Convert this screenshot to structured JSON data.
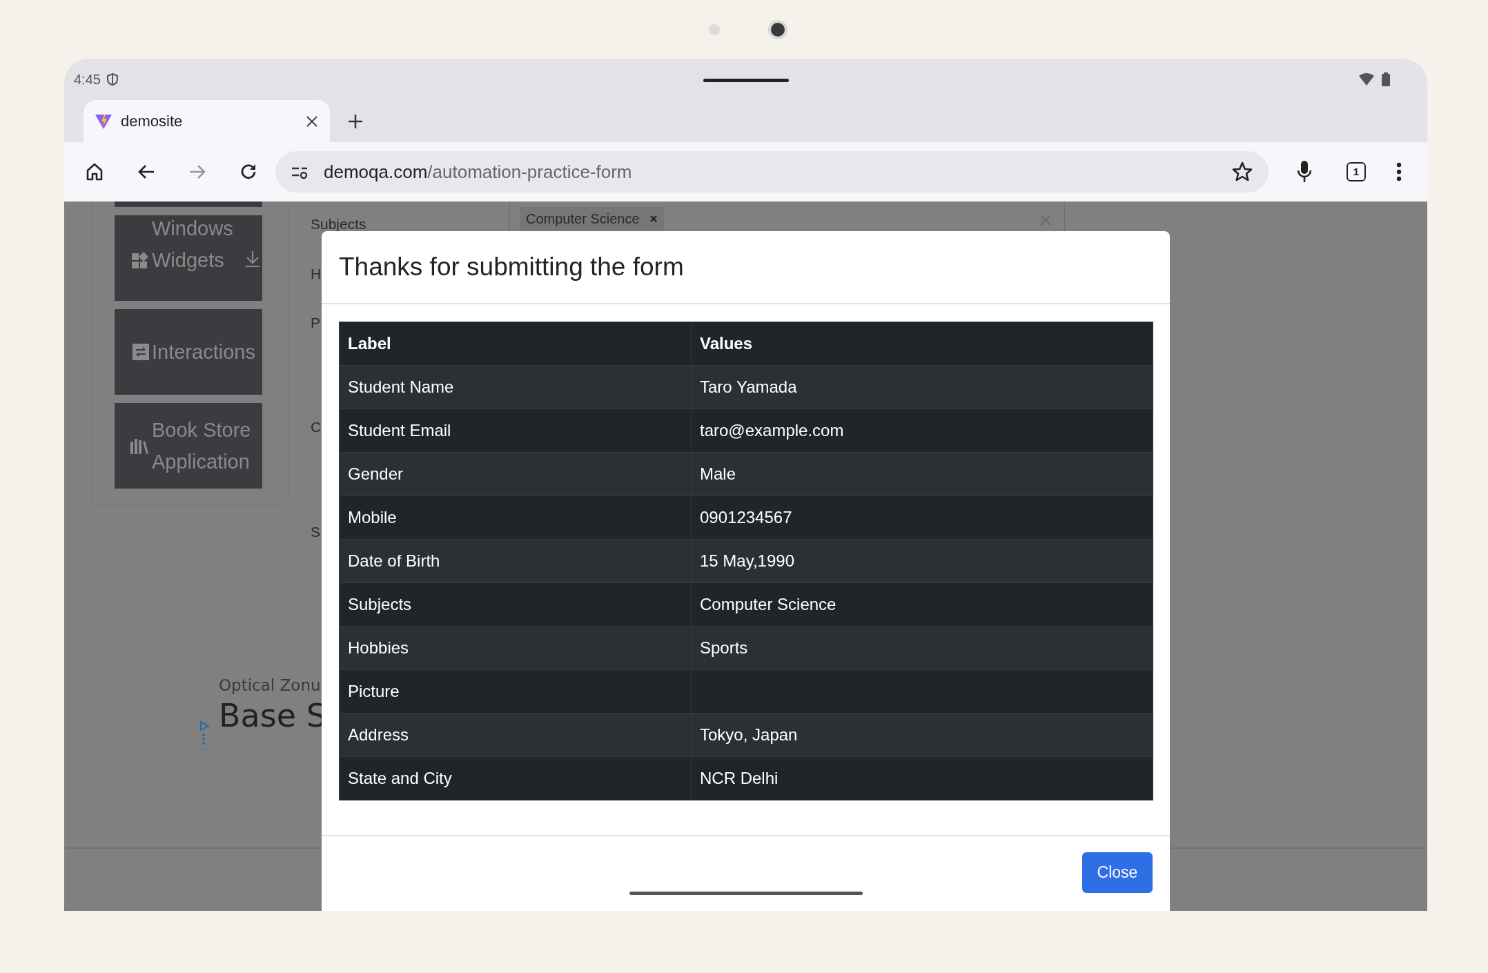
{
  "status_bar": {
    "time": "4:45"
  },
  "browser": {
    "tab": {
      "title": "demosite",
      "selected": true
    },
    "url": {
      "host": "demoqa.com",
      "path": "/automation-practice-form"
    },
    "tab_count": "1"
  },
  "page": {
    "sidebar_items": [
      {
        "lines": [
          "Windows",
          "Widgets"
        ]
      },
      {
        "lines": [
          "Interactions"
        ]
      },
      {
        "lines": [
          "Book Store",
          "Application"
        ]
      }
    ],
    "form_labels": [
      "Subjects",
      "H",
      "P",
      "C",
      "S"
    ],
    "subjects_chip": "Computer Science",
    "ad": {
      "advertiser": "Optical Zonu",
      "headline": "Base S"
    }
  },
  "modal": {
    "title": "Thanks for submitting the form",
    "columns": [
      "Label",
      "Values"
    ],
    "rows": [
      {
        "label": "Student Name",
        "value": "Taro Yamada"
      },
      {
        "label": "Student Email",
        "value": "taro@example.com"
      },
      {
        "label": "Gender",
        "value": "Male"
      },
      {
        "label": "Mobile",
        "value": "0901234567"
      },
      {
        "label": "Date of Birth",
        "value": "15 May,1990"
      },
      {
        "label": "Subjects",
        "value": "Computer Science"
      },
      {
        "label": "Hobbies",
        "value": "Sports"
      },
      {
        "label": "Picture"
      },
      {
        "label": "Address",
        "value": "Tokyo, Japan"
      },
      {
        "label": "State and City",
        "value": "NCR Delhi"
      }
    ],
    "close_button": "Close"
  }
}
